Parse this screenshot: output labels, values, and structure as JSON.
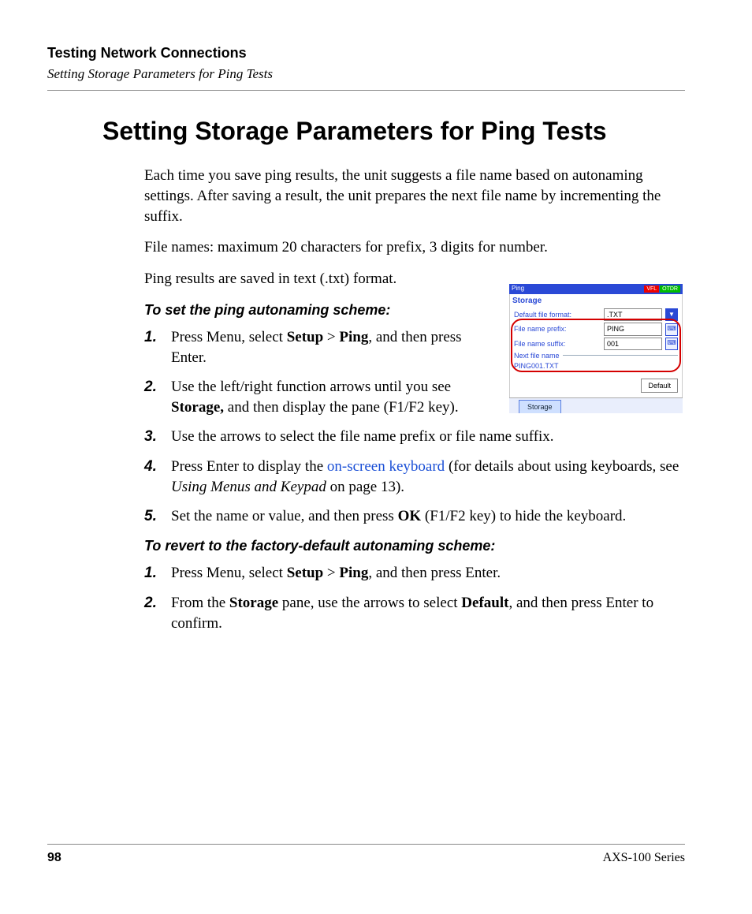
{
  "header": {
    "chapter": "Testing Network Connections",
    "section": "Setting Storage Parameters for Ping Tests"
  },
  "title": "Setting Storage Parameters for Ping Tests",
  "intro": [
    "Each time you save ping results, the unit suggests a file name based on autonaming settings. After saving a result, the unit prepares the next file name by incrementing the suffix.",
    "File names: maximum 20 characters for prefix, 3 digits for number.",
    "Ping results are saved in text (.txt) format."
  ],
  "proc1": {
    "heading": "To set the ping autonaming scheme:",
    "steps": [
      {
        "pre": "Press Menu, select ",
        "b1": "Setup",
        "mid": " > ",
        "b2": "Ping",
        "post": ", and then press Enter."
      },
      {
        "pre": "Use the left/right function arrows until you see ",
        "b1": "Storage,",
        "post": " and then display the pane (F1/F2 key)."
      },
      {
        "plain": "Use the arrows to select the file name prefix or file name suffix."
      },
      {
        "pre": "Press Enter to display the ",
        "link": "on-screen keyboard",
        "post": " (for details about using keyboards, see ",
        "i": "Using Menus and Keypad",
        "tail": " on page 13)."
      },
      {
        "pre": "Set the name or value, and then press ",
        "b1": "OK",
        "post": " (F1/F2 key) to hide the keyboard."
      }
    ]
  },
  "proc2": {
    "heading": "To revert to the factory-default autonaming scheme:",
    "steps": [
      {
        "pre": "Press Menu, select ",
        "b1": "Setup",
        "mid": " > ",
        "b2": "Ping",
        "post": ", and then press Enter."
      },
      {
        "pre": "From the ",
        "b1": "Storage",
        "mid2": " pane, use the arrows to select ",
        "b2": "Default",
        "post": ", and then press Enter to confirm."
      }
    ]
  },
  "shot": {
    "title": "Ping",
    "badges": {
      "vfl": "VFL",
      "otdr": "OTDR"
    },
    "section": "Storage",
    "rows": {
      "format": {
        "label": "Default file format:",
        "value": ".TXT"
      },
      "prefix": {
        "label": "File name prefix:",
        "value": "PING"
      },
      "suffix": {
        "label": "File name suffix:",
        "value": "001"
      }
    },
    "next_label": "Next file name",
    "next_value": "PING001.TXT",
    "default_btn": "Default",
    "tab": "Storage"
  },
  "footer": {
    "page": "98",
    "series": "AXS-100 Series"
  }
}
